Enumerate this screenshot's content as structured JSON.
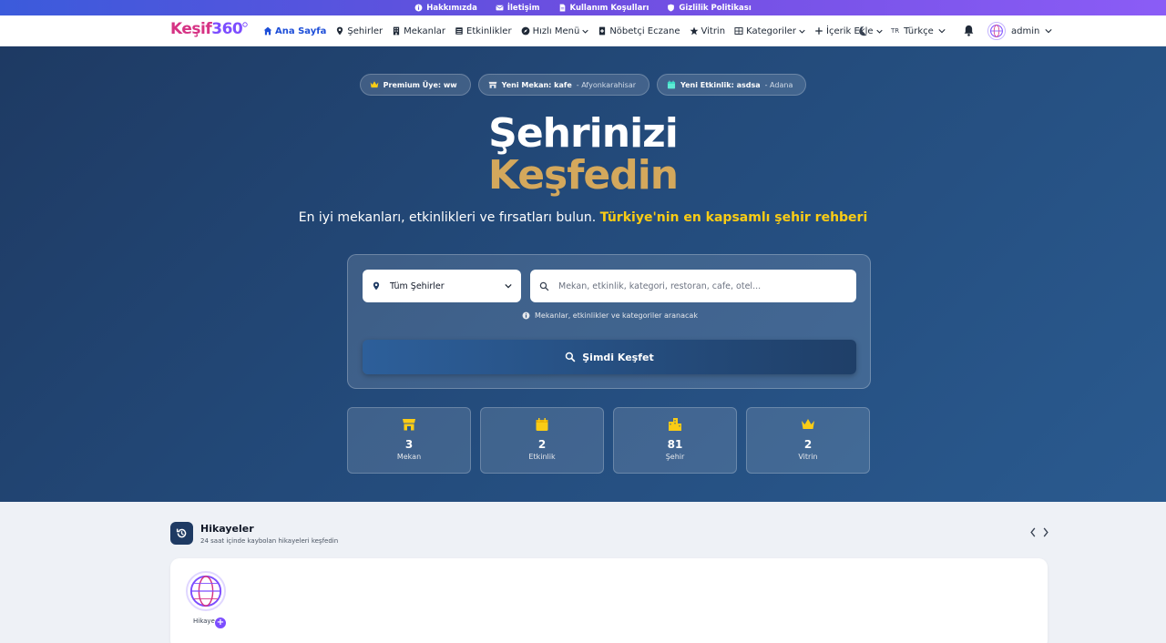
{
  "topbar": {
    "items": [
      {
        "label": "Hakkımızda",
        "icon": "info-circle-icon"
      },
      {
        "label": "İletişim",
        "icon": "envelope-icon"
      },
      {
        "label": "Kullanım Koşulları",
        "icon": "file-icon"
      },
      {
        "label": "Gizlilik Politikası",
        "icon": "shield-icon"
      }
    ]
  },
  "nav": {
    "logo_a": "Keşif",
    "logo_b": "360",
    "links": [
      {
        "label": "Ana Sayfa",
        "icon": "home-icon"
      },
      {
        "label": "Şehirler",
        "icon": "map-pin-icon"
      },
      {
        "label": "Mekanlar",
        "icon": "building-icon"
      },
      {
        "label": "Etkinlikler",
        "icon": "list-icon"
      },
      {
        "label": "Hızlı Menü",
        "icon": "compass-icon"
      },
      {
        "label": "Nöbetçi Eczane",
        "icon": "pharmacy-icon"
      },
      {
        "label": "Vitrin",
        "icon": "star-icon"
      },
      {
        "label": "Kategoriler",
        "icon": "grid-icon"
      },
      {
        "label": "İçerik Ekle",
        "icon": "plus-icon"
      }
    ],
    "lang_code": "TR",
    "lang_label": "Türkçe",
    "user_name": "admin",
    "colors": {
      "brand_pink": "#d63384",
      "brand_purple": "#7c4dff",
      "active": "#1d4ed8"
    }
  },
  "hero": {
    "pills": [
      {
        "bold": "Premium Üye: ww",
        "rest": "",
        "icon": "crown-icon"
      },
      {
        "bold": "Yeni Mekan: kafe",
        "rest": " - Afyonkarahisar",
        "icon": "store-icon"
      },
      {
        "bold": "Yeni Etkinlik: asdsa",
        "rest": " - Adana",
        "icon": "calendar-icon"
      }
    ],
    "title_a": "Şehrinizi",
    "title_b": "Keşfedin",
    "tagline": "En iyi mekanları, etkinlikleri ve fırsatları bulun.",
    "tagline_highlight": "Türkiye'nin en kapsamlı şehir rehberi",
    "colors": {
      "gold": "#d4a85c",
      "yellow": "#facc15",
      "bg": "#234a7a"
    }
  },
  "search": {
    "city_value": "Tüm Şehirler",
    "placeholder": "Mekan, etkinlik, kategori, restoran, cafe, otel...",
    "hint": "Mekanlar, etkinlikler ve kategoriler aranacak",
    "button": "Şimdi Keşfet"
  },
  "stats": [
    {
      "value": "3",
      "label": "Mekan",
      "icon": "store-icon"
    },
    {
      "value": "2",
      "label": "Etkinlik",
      "icon": "calendar-icon"
    },
    {
      "value": "81",
      "label": "Şehir",
      "icon": "city-icon"
    },
    {
      "value": "2",
      "label": "Vitrin",
      "icon": "crown-icon"
    }
  ],
  "stories": {
    "title": "Hikayeler",
    "subtitle": "24 saat içinde kaybolan hikayeleri keşfedin",
    "add_label": "Hikaye Ekle",
    "add_plus": "+"
  }
}
